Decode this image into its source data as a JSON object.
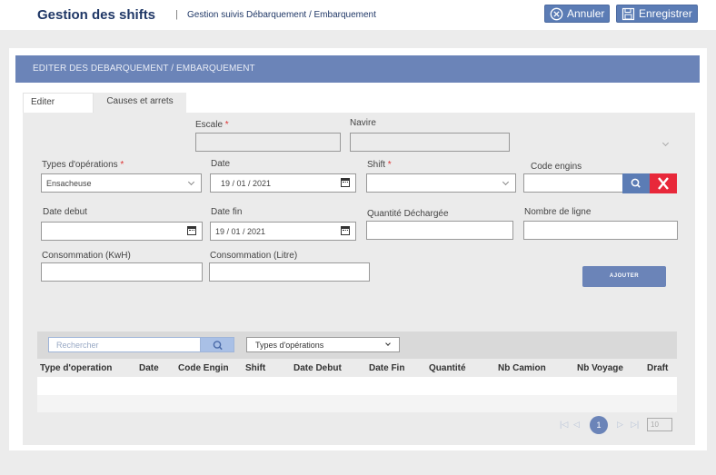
{
  "header": {
    "app_title": "Gestion des shifts",
    "separator": "|",
    "subtitle": "Gestion suivis Débarquement / Embarquement",
    "cancel_label": "Annuler",
    "save_label": "Enregistrer"
  },
  "section_title": "EDITER  DES DEBARQUEMENT / EMBARQUEMENT",
  "tabs": [
    {
      "label": "Editer",
      "active": true
    },
    {
      "label": "Causes et arrets",
      "active": false
    }
  ],
  "form": {
    "escale": {
      "label": "Escale",
      "required": "*",
      "value": ""
    },
    "navire": {
      "label": "Navire",
      "value": ""
    },
    "types_operations": {
      "label": "Types d'opérations",
      "required": "*",
      "value": "Ensacheuse"
    },
    "date": {
      "label": "Date",
      "value": "19 / 01 / 2021"
    },
    "shift": {
      "label": "Shift",
      "required": "*",
      "value": ""
    },
    "code_engins": {
      "label": "Code engins",
      "value": ""
    },
    "date_debut": {
      "label": "Date debut",
      "value": ""
    },
    "date_fin": {
      "label": "Date fin",
      "value": "19 / 01 / 2021"
    },
    "quantite_dechargee": {
      "label": "Quantité Déchargée",
      "value": ""
    },
    "nombre_ligne": {
      "label": "Nombre de ligne",
      "value": ""
    },
    "consommation_kwh": {
      "label": "Consommation (KwH)",
      "value": ""
    },
    "consommation_litre": {
      "label": "Consommation (Litre)",
      "value": ""
    },
    "add_label": "AJOUTER"
  },
  "grid": {
    "search_placeholder": "Rechercher",
    "filter_value": "Types d'opérations",
    "columns": [
      "Type d'operation",
      "Date",
      "Code Engin",
      "Shift",
      "Date Debut",
      "Date Fin",
      "Quantité",
      "Nb Camion",
      "Nb Voyage",
      "Draft"
    ],
    "rows": []
  },
  "pager": {
    "current_page": "1",
    "page_size": "10"
  },
  "colors": {
    "brand_dark": "#1f3766",
    "accent": "#6b84b8",
    "button": "#5b7cb5",
    "danger": "#e8283a"
  },
  "icons": [
    "cancel-icon",
    "save-icon",
    "calendar-icon",
    "search-icon",
    "close-icon",
    "chevron-down-icon",
    "first-page-icon",
    "prev-page-icon",
    "next-page-icon",
    "last-page-icon"
  ]
}
